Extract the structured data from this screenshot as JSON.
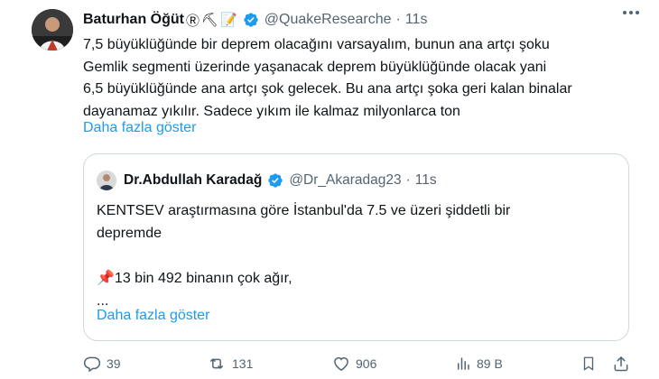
{
  "tweet": {
    "author": {
      "name": "Baturhan Öğüt",
      "badges": [
        "Ⓡ",
        "⛏",
        "📝"
      ],
      "handle": "@QuakeResearche",
      "separator": "·",
      "time": "11s"
    },
    "text_lines": [
      "7,5 büyüklüğünde bir deprem olacağını varsayalım, bunun ana artçı şoku",
      "Gemlik segmenti üzerinde yaşanacak deprem büyüklüğünde olacak yani",
      "6,5 büyüklüğünde ana artçı şok gelecek. Bu ana artçı şoka geri kalan binalar",
      "dayanamaz yıkılır. Sadece yıkım ile kalmaz milyonlarca ton"
    ],
    "show_more": "Daha fazla göster"
  },
  "quote": {
    "author": {
      "name": "Dr.Abdullah Karadağ",
      "handle": "@Dr_Akaradag23",
      "separator": "·",
      "time": "11s"
    },
    "text_lines": [
      "KENTSEV araştırmasına göre İstanbul'da 7.5 ve üzeri şiddetli bir",
      "depremde",
      "",
      "13 bin 492 binanın çok ağır,",
      "..."
    ],
    "pin_emoji": "📌",
    "show_more": "Daha fazla göster"
  },
  "actions": {
    "replies": "39",
    "retweets": "131",
    "likes": "906",
    "views": "89 B"
  },
  "colors": {
    "text": "#0f1419",
    "secondary": "#536471",
    "link": "#1d9bf0",
    "verified": "#1d9bf0",
    "border": "#cfd9de"
  }
}
